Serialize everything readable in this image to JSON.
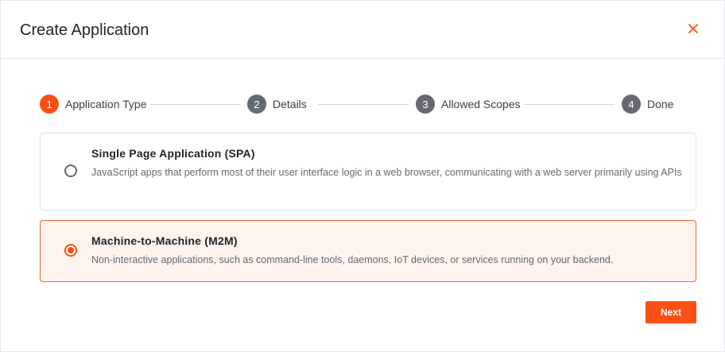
{
  "dialog": {
    "title": "Create Application",
    "close_icon": "close-x-icon",
    "close_color": "#fa5014"
  },
  "steps": [
    {
      "number": "1",
      "label": "Application Type",
      "active": true
    },
    {
      "number": "2",
      "label": "Details",
      "active": false
    },
    {
      "number": "3",
      "label": "Allowed Scopes",
      "active": false
    },
    {
      "number": "4",
      "label": "Done",
      "active": false
    }
  ],
  "options": [
    {
      "title": "Single Page Application (SPA)",
      "description": "JavaScript apps that perform most of their user interface logic in a web browser, communicating with a web server primarily using APIs",
      "selected": false
    },
    {
      "title": "Machine-to-Machine (M2M)",
      "description": "Non-interactive applications, such as command-line tools, daemons, IoT devices, or services running on your backend.",
      "selected": true
    }
  ],
  "footer": {
    "next_label": "Next"
  },
  "colors": {
    "accent": "#fa5014",
    "selected_border": "#e8662e",
    "selected_bg": "#fff3ed",
    "step_inactive": "#646a73"
  }
}
